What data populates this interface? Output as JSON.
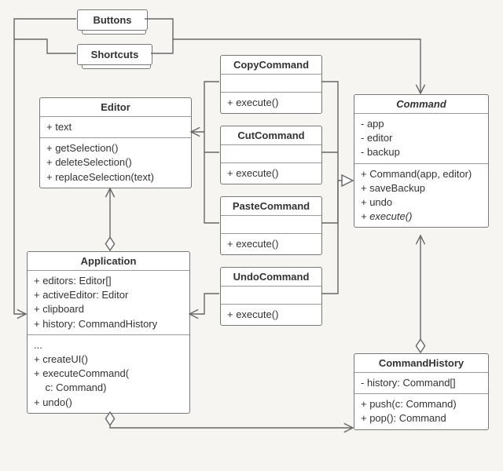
{
  "buttons": {
    "label": "Buttons"
  },
  "shortcuts": {
    "label": "Shortcuts"
  },
  "editor": {
    "title": "Editor",
    "fields": [
      "+ text"
    ],
    "methods": [
      "+ getSelection()",
      "+ deleteSelection()",
      "+ replaceSelection(text)"
    ]
  },
  "application": {
    "title": "Application",
    "fields": [
      "+ editors: Editor[]",
      "+ activeEditor: Editor",
      "+ clipboard",
      "+ history: CommandHistory"
    ],
    "methods": [
      "...",
      "+ createUI()",
      "+ executeCommand(",
      "    c: Command)",
      "+ undo()"
    ]
  },
  "copy": {
    "title": "CopyCommand",
    "method": "+ execute()"
  },
  "cut": {
    "title": "CutCommand",
    "method": "+ execute()"
  },
  "paste": {
    "title": "PasteCommand",
    "method": "+ execute()"
  },
  "undo": {
    "title": "UndoCommand",
    "method": "+ execute()"
  },
  "command": {
    "title": "Command",
    "fields": [
      "- app",
      "- editor",
      "- backup"
    ],
    "methods_plain": [
      "+ Command(app, editor)",
      "+ saveBackup",
      "+ undo"
    ],
    "method_abstract": "+ execute()"
  },
  "history": {
    "title": "CommandHistory",
    "fields": [
      "- history: Command[]"
    ],
    "methods": [
      "+ push(c: Command)",
      "+ pop(): Command"
    ]
  }
}
